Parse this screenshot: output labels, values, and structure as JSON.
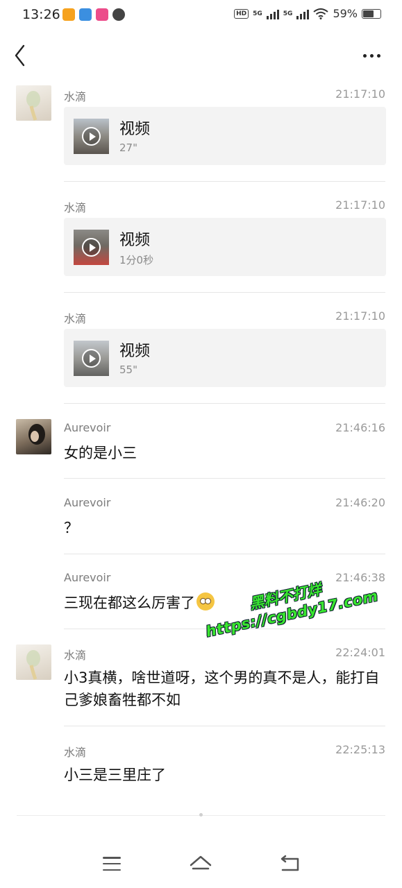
{
  "status_bar": {
    "time": "13:26",
    "network_tag_1": "HD",
    "network_tag_2": "5G",
    "network_tag_3": "5G",
    "battery": "59%"
  },
  "nav": {
    "back_icon": "chevron-left-icon",
    "more_icon": "more-horizontal-icon"
  },
  "messages": [
    {
      "sender": "水滴",
      "time": "21:17:10",
      "video": {
        "title": "视频",
        "duration": "27\""
      }
    },
    {
      "sender": "水滴",
      "time": "21:17:10",
      "video": {
        "title": "视频",
        "duration": "1分0秒"
      }
    },
    {
      "sender": "水滴",
      "time": "21:17:10",
      "video": {
        "title": "视频",
        "duration": "55\""
      }
    },
    {
      "sender": "Aurevoir",
      "time": "21:46:16",
      "text": "女的是小三"
    },
    {
      "sender": "Aurevoir",
      "time": "21:46:20",
      "text": "？"
    },
    {
      "sender": "Aurevoir",
      "time": "21:46:38",
      "text": "三现在都这么厉害了"
    },
    {
      "sender": "水滴",
      "time": "22:24:01",
      "text": "小3真横，啥世道呀，这个男的真不是人，能打自己爹娘畜牲都不如"
    },
    {
      "sender": "水滴",
      "time": "22:25:13",
      "text": "小三是三里庄了"
    }
  ],
  "watermark": {
    "line1": "黑料不打烊",
    "line2": "https://cgbdy17.com"
  },
  "system_nav": {
    "menu_icon": "menu-icon",
    "home_icon": "home-icon",
    "back_icon": "back-icon"
  }
}
